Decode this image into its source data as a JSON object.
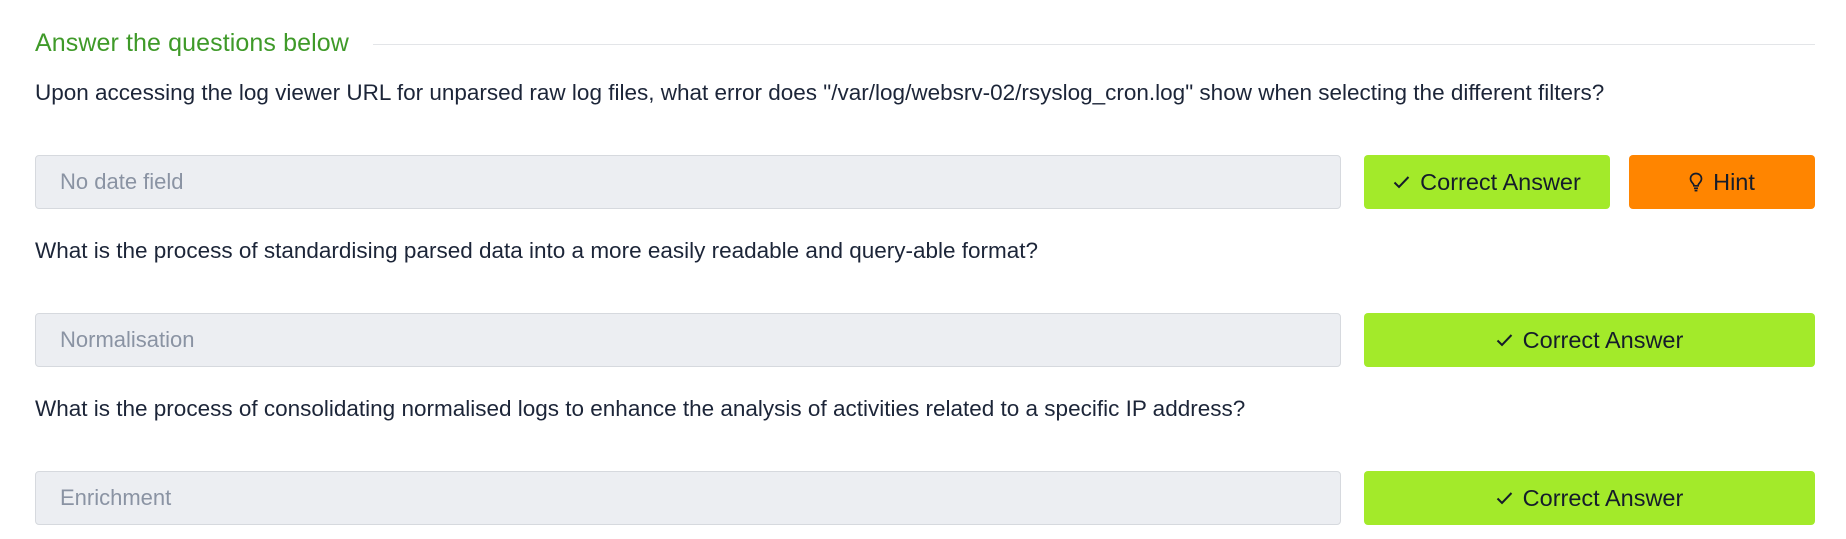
{
  "section": {
    "title": "Answer the questions below"
  },
  "questions": [
    {
      "question": "Upon accessing the log viewer URL for unparsed raw log files, what error does \"/var/log/websrv-02/rsyslog_cron.log\" show when selecting the different filters?",
      "answer": "No date field",
      "submit_label": "Correct Answer",
      "hint_label": "Hint"
    },
    {
      "question": "What is the process of standardising parsed data into a more easily readable and query-able format?",
      "answer": "Normalisation",
      "submit_label": "Correct Answer"
    },
    {
      "question": "What is the process of consolidating normalised logs to enhance the analysis of activities related to a specific IP address?",
      "answer": "Enrichment",
      "submit_label": "Correct Answer"
    }
  ],
  "icons": {
    "correct": "check-icon",
    "hint": "lightbulb-icon"
  },
  "colors": {
    "section_title": "#3f9a29",
    "correct_button": "#a3ea2a",
    "hint_button": "#ff8500",
    "answer_field_bg": "#eceef2",
    "question_text": "#1c2538"
  }
}
